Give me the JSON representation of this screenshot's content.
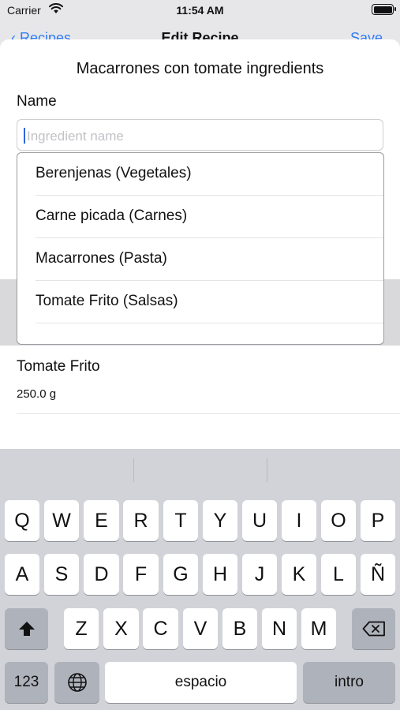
{
  "status_bar": {
    "carrier": "Carrier",
    "time": "11:54 AM"
  },
  "nav_behind": {
    "back_label": "Recipes",
    "title": "Edit Recipe",
    "save_label": "Save"
  },
  "sheet": {
    "title": "Macarrones con tomate ingredients",
    "name_label": "Name",
    "name_input": {
      "placeholder": "Ingredient name",
      "value": ""
    },
    "suggestions": [
      "Berenjenas (Vegetales)",
      "Carne picada (Carnes)",
      "Macarrones (Pasta)",
      "Tomate Frito (Salsas)"
    ],
    "ingredient": {
      "name": "Tomate Frito",
      "quantity": "250.0 g"
    }
  },
  "keyboard": {
    "row1": [
      "Q",
      "W",
      "E",
      "R",
      "T",
      "Y",
      "U",
      "I",
      "O",
      "P"
    ],
    "row2": [
      "A",
      "S",
      "D",
      "F",
      "G",
      "H",
      "J",
      "K",
      "L",
      "Ñ"
    ],
    "row3": [
      "Z",
      "X",
      "C",
      "V",
      "B",
      "N",
      "M"
    ],
    "numbers_label": "123",
    "space_label": "espacio",
    "return_label": "intro"
  }
}
